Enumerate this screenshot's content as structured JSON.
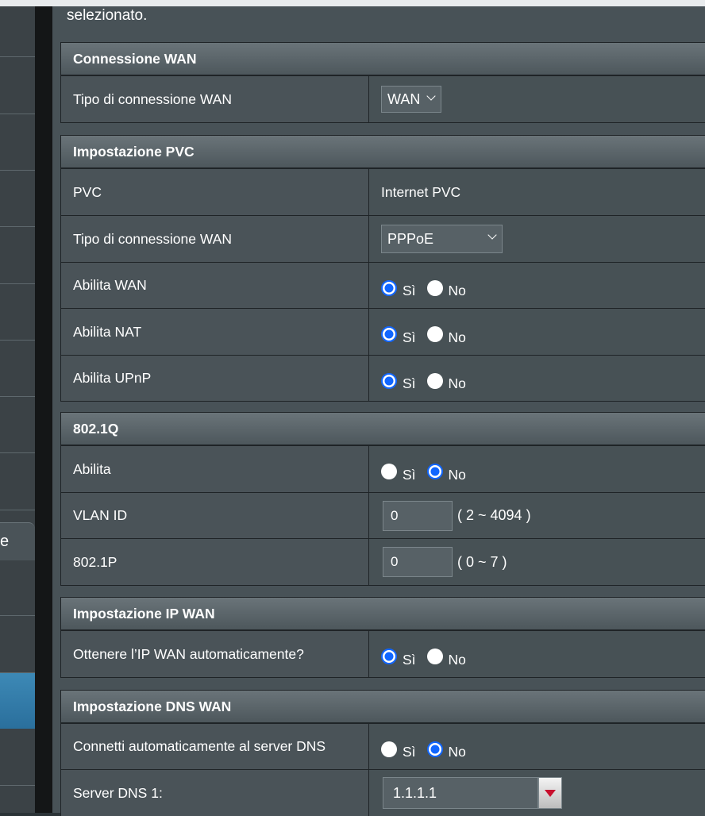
{
  "intro_text": "selezionato.",
  "sidebar": {
    "tab_fragment": "e"
  },
  "wan_connection": {
    "header": "Connessione WAN",
    "rows": [
      {
        "label": "Tipo di connessione WAN",
        "value": "WAN"
      }
    ]
  },
  "pvc": {
    "header": "Impostazione PVC",
    "pvc_label": "PVC",
    "pvc_value": "Internet PVC",
    "conn_type_label": "Tipo di connessione WAN",
    "conn_type_value": "PPPoE",
    "enable_wan": {
      "label": "Abilita WAN",
      "yes": "Sì",
      "no": "No",
      "selected": "yes"
    },
    "enable_nat": {
      "label": "Abilita NAT",
      "yes": "Sì",
      "no": "No",
      "selected": "yes"
    },
    "enable_upnp": {
      "label": "Abilita UPnP",
      "yes": "Sì",
      "no": "No",
      "selected": "yes"
    }
  },
  "dot1q": {
    "header": "802.1Q",
    "enable": {
      "label": "Abilita",
      "yes": "Sì",
      "no": "No",
      "selected": "no"
    },
    "vlan_id": {
      "label": "VLAN ID",
      "value": "0",
      "hint": "( 2 ~ 4094 )"
    },
    "dot1p": {
      "label": "802.1P",
      "value": "0",
      "hint": "( 0 ~ 7 )"
    }
  },
  "wan_ip": {
    "header": "Impostazione IP WAN",
    "auto_ip": {
      "label": "Ottenere l’IP WAN automaticamente?",
      "yes": "Sì",
      "no": "No",
      "selected": "yes"
    }
  },
  "wan_dns": {
    "header": "Impostazione DNS WAN",
    "auto_dns": {
      "label": "Connetti automaticamente al server DNS",
      "yes": "Sì",
      "no": "No",
      "selected": "no"
    },
    "dns1": {
      "label": "Server DNS 1:",
      "value": "1.1.1.1"
    }
  },
  "colors": {
    "radio_selected": "#1166ff",
    "background": "#485257",
    "header": "#5b656a",
    "dropdown_arrow": "#c8102e"
  }
}
